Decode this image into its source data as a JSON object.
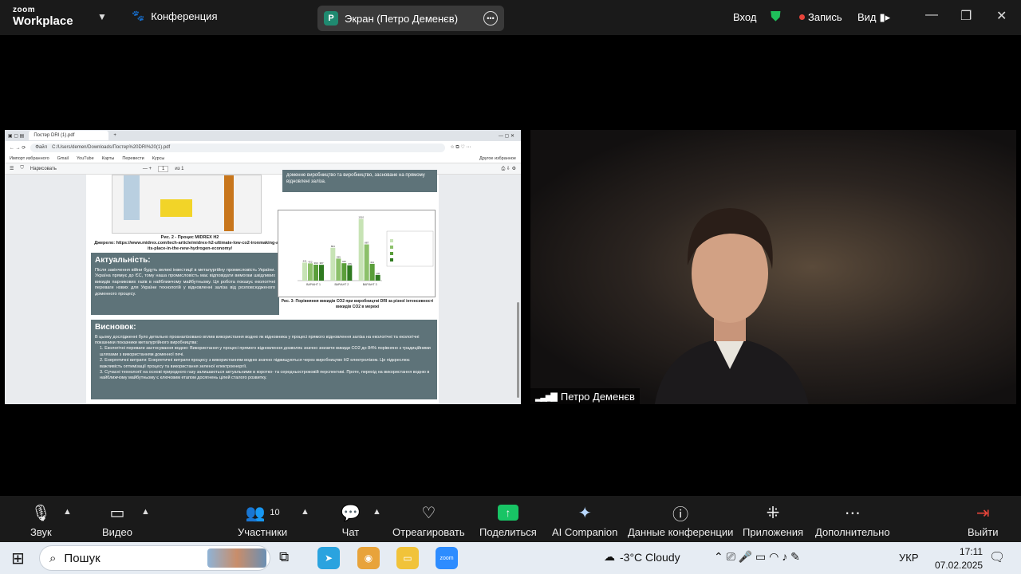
{
  "app": {
    "brand_top": "zoom",
    "brand_bottom": "Workplace",
    "meeting_label": "Конференция"
  },
  "share": {
    "avatar_letter": "P",
    "title": "Экран (Петро Деменєв)"
  },
  "topbar": {
    "signin": "Вход",
    "record": "Запись",
    "view": "Вид"
  },
  "browser": {
    "tab_title": "Постер DRI (1).pdf",
    "file_label": "Файл",
    "url": "C:/Users/demen/Downloads/Постер%20DRI%20(1).pdf",
    "bookmarks": [
      "Импорт избранного",
      "Gmail",
      "YouTube",
      "Карты",
      "Перевести",
      "Курсы"
    ],
    "other_bookmarks": "Другое избранное",
    "pdf_draw": "Нарисовать",
    "page_num": "1",
    "page_total": "из 1"
  },
  "poster": {
    "caption_title": "Рис. 2 - Процес MIDREX H2",
    "caption_source": "Джерело: https://www.midrex.com/tech-article/midrex-h2-ultimate-low-co2-ironmaking-and-its-place-in-the-new-hydrogen-economy/",
    "top_box_text": "доменне виробництво та виробництво, засноване на прямому відновлені заліза.",
    "actual_title": "Актуальність:",
    "actual_text": "Після закінчення війни будуть великі інвестиції в металургійну промисловість України. Україна прямує до ЄС, тому наша промисловість має відповідати вимогам шкідливих викидів парникових газів в найближчому майбутньому. Ця робота показує екологічні переваги нових для України технологій у відновленні заліза від розповсюдженого доменного процесу.",
    "concl_title": "Висновок:",
    "concl_intro": "В цьому дослідженні було детально проаналізовано вплив використання водню як відновника у процесі прямого відновлення заліза на екологічні та екологічні показники показники металургійного виробництва:",
    "concl_items": [
      "1. Екологічні переваги застосування водню: Використання у процесі прямого відновлення дозволяє значно знизити викиди CO2 до 84% порівняно з традиційними шляхами з використанням доменної печі.",
      "2. Енергетичні витрати: Енергетичні витрати процесу з використанням водню значно підвищуються через виробництво H2 електролізом. Це підкреслює важливість оптимізації процесу та використання зеленої електроенергії.",
      "3. Сучасні технології на основі природного газу залишаються актуальними в коротко- та середньостроковій перспективі. Проте, перехід на використання водню в найближчому майбутньому є ключовим етапом досягнень цілей сталого розвитку."
    ],
    "fig_caption": "Рис. 3: Порівняння викидів CO2 при виробництві DRI за різної інтенсивності викидів CO2 в мережі"
  },
  "chart_data": {
    "type": "bar",
    "ylim": [
      0,
      1600
    ],
    "categories": [
      "ВАРІАНТ 1",
      "ВАРІАНТ 2",
      "ВАРІАНТ 3"
    ],
    "series": [
      {
        "name": "",
        "values": [
          441,
          804,
          1510
        ]
      },
      {
        "name": "",
        "values": [
          422,
          539,
          887
        ]
      },
      {
        "name": "",
        "values": [
          390,
          426,
          411
        ]
      },
      {
        "name": "",
        "values": [
          387,
          375,
          140
        ]
      }
    ],
    "colors": [
      "#c7e3b5",
      "#8cc06a",
      "#5a9e3a",
      "#2f7a20"
    ]
  },
  "participant": {
    "name": "Петро Деменєв"
  },
  "toolbar": {
    "audio": "Звук",
    "video": "Видео",
    "participants": "Участники",
    "participants_count": "10",
    "chat": "Чат",
    "react": "Отреагировать",
    "share": "Поделиться",
    "companion": "AI Companion",
    "info": "Данные конференции",
    "apps": "Приложения",
    "more": "Дополнительно",
    "leave": "Выйти"
  },
  "taskbar": {
    "search_placeholder": "Пошук",
    "weather": "-3°C  Cloudy",
    "lang": "УКР",
    "time": "17:11",
    "date": "07.02.2025"
  },
  "colors": {
    "accent_green": "#1fbf5a",
    "record_red": "#e8443a",
    "share_green": "#18c465",
    "poster_box": "#5e7379"
  }
}
